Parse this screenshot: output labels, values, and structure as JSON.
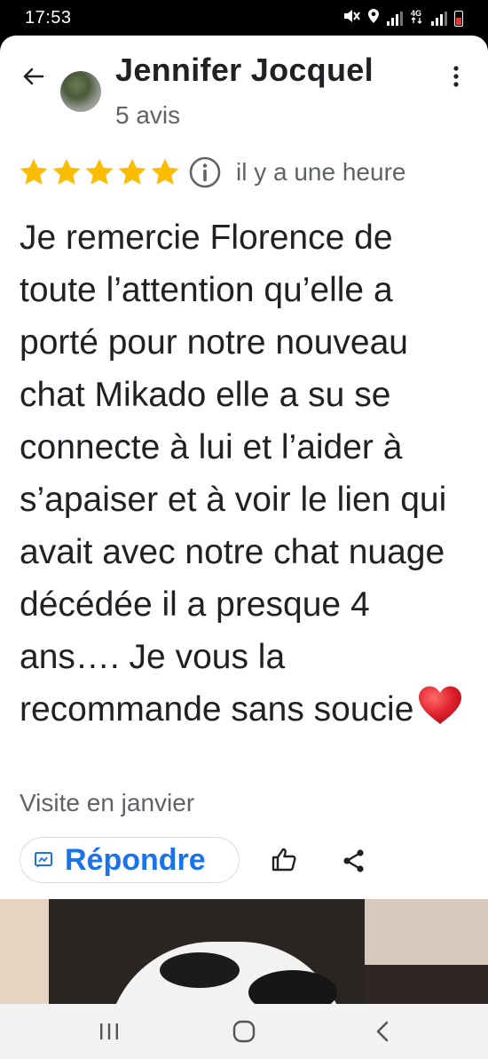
{
  "status_bar": {
    "time": "17:53",
    "icons": [
      "mute-icon",
      "location-icon",
      "signal-icon",
      "4g-icon",
      "signal-icon",
      "battery-icon"
    ]
  },
  "review": {
    "reviewer_name": "Jennifer Jocquel",
    "review_count": "5 avis",
    "rating": 5,
    "rating_max": 5,
    "time_ago": "il y a une heure",
    "text": "Je remercie Florence de toute l’attention qu’elle a porté pour notre nouveau chat Mikado elle a su se connecte à lui et l’aider à s’apaiser et à voir le lien qui avait avec notre chat nuage décédée il a presque 4 ans…. Je vous la recommande sans soucie",
    "visit": "Visite en janvier"
  },
  "actions": {
    "reply_label": "Répondre",
    "like_icon": "thumbs-up-icon",
    "share_icon": "share-icon"
  },
  "colors": {
    "star": "#fbbc04",
    "accent": "#1a73e8",
    "heart": "#e0202a",
    "text_primary": "#202124",
    "text_secondary": "#5f6368"
  }
}
